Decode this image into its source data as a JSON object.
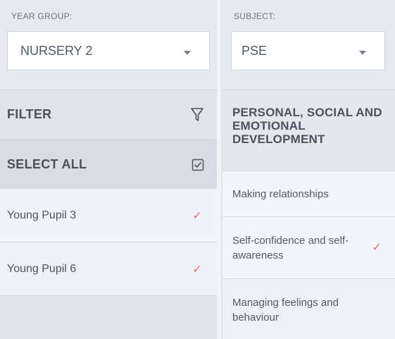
{
  "left": {
    "year_group": {
      "caption": "YEAR GROUP:",
      "value": "NURSERY 2"
    },
    "filter_label": "FILTER",
    "select_all_label": "SELECT ALL",
    "pupils": [
      {
        "name": "Young Pupil 3",
        "checked": true
      },
      {
        "name": "Young Pupil 6",
        "checked": true
      }
    ]
  },
  "right": {
    "subject": {
      "caption": "SUBJECT:",
      "value": "PSE"
    },
    "area_title": "PERSONAL, SOCIAL AND EMOTIONAL DEVELOPMENT",
    "strands": [
      {
        "label": "Making relationships",
        "checked": false
      },
      {
        "label": "Self-confidence and self-awareness",
        "checked": true
      },
      {
        "label": "Managing feelings and behaviour",
        "checked": false
      }
    ]
  },
  "colors": {
    "tick": "#e46a6a",
    "panel": "#dfe3ea",
    "row_light": "#eef1f6"
  }
}
